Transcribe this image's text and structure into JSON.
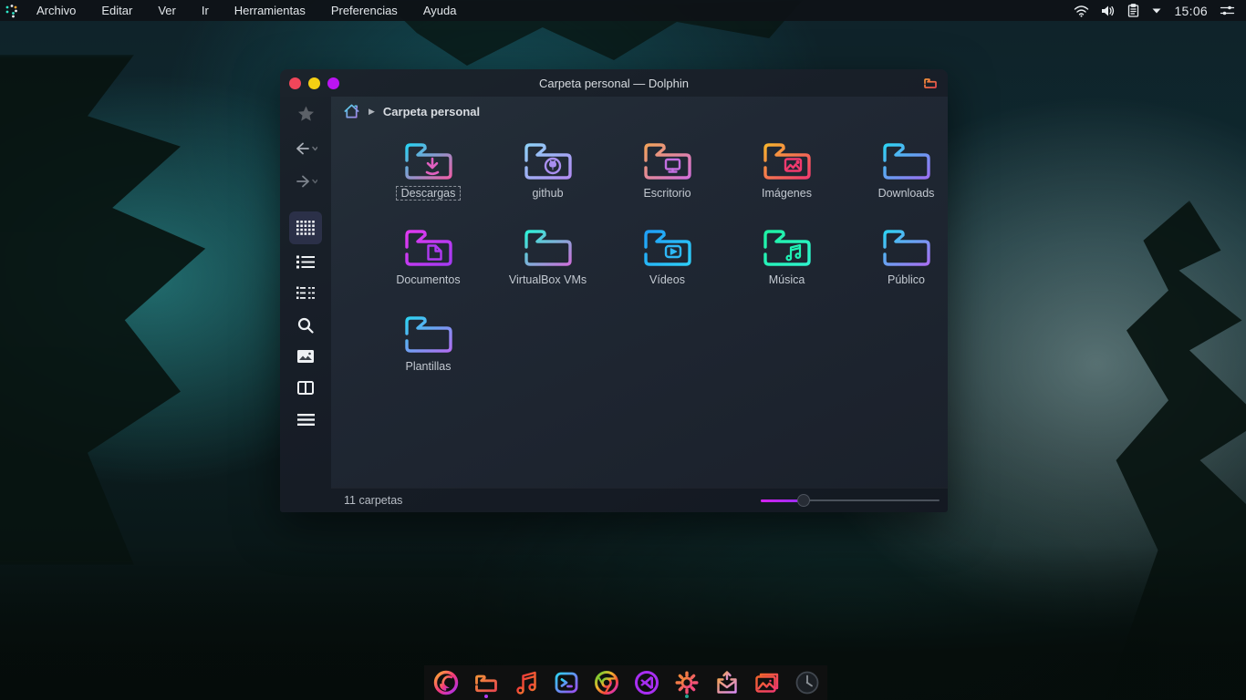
{
  "menubar": {
    "logo": "distro-dotted-question-logo",
    "items": [
      "Archivo",
      "Editar",
      "Ver",
      "Ir",
      "Herramientas",
      "Preferencias",
      "Ayuda"
    ],
    "tray": {
      "icons": [
        "wifi-icon",
        "volume-icon",
        "clipboard-icon",
        "expander-caret-icon",
        "tweaks-sliders-icon"
      ],
      "clock": "15:06"
    }
  },
  "window": {
    "title": "Carpeta personal — Dolphin",
    "app_icon": "orange-folder-icon",
    "traffic_lights": {
      "close": "#f0465a",
      "minimize": "#f5d013",
      "maximize": "#bb14f2"
    },
    "breadcrumb": {
      "root_icon": "home-icon",
      "separator": "▶",
      "current": "Carpeta personal"
    },
    "sidebar": {
      "tools": [
        "favorite-star",
        "back",
        "forward",
        "icons-view (active)",
        "list-view",
        "compact-view",
        "search",
        "preview",
        "split-view",
        "menu"
      ]
    },
    "folders": [
      {
        "label": "Descargas",
        "glyph": "download-arrow",
        "colors": [
          "#29d2f2",
          "#ec5fa8"
        ],
        "selected": true
      },
      {
        "label": "github",
        "glyph": "github-octocat",
        "colors": [
          "#8fd0f7",
          "#b18cf2"
        ],
        "selected": false
      },
      {
        "label": "Escritorio",
        "glyph": "monitor",
        "colors": [
          "#f2a25c",
          "#d36fd9"
        ],
        "selected": false
      },
      {
        "label": "Imágenes",
        "glyph": "image",
        "colors": [
          "#f7b32e",
          "#f23a6e"
        ],
        "selected": false
      },
      {
        "label": "Downloads",
        "glyph": "none",
        "colors": [
          "#2ed2f2",
          "#9b6ef2"
        ],
        "selected": false
      },
      {
        "label": "Documentos",
        "glyph": "document",
        "colors": [
          "#e03af0",
          "#a43af2"
        ],
        "selected": false
      },
      {
        "label": "VirtualBox VMs",
        "glyph": "none",
        "colors": [
          "#2ef2d8",
          "#cc6fd9"
        ],
        "selected": false
      },
      {
        "label": "Vídeos",
        "glyph": "video-play",
        "colors": [
          "#1f9ff7",
          "#2ecdf7"
        ],
        "selected": false
      },
      {
        "label": "Música",
        "glyph": "music-notes",
        "colors": [
          "#1ef2a4",
          "#2ef2cc"
        ],
        "selected": false
      },
      {
        "label": "Público",
        "glyph": "none",
        "colors": [
          "#2ed2f2",
          "#a86ef2"
        ],
        "selected": false
      },
      {
        "label": "Plantillas",
        "glyph": "none",
        "colors": [
          "#2ed2f2",
          "#b06ef2"
        ],
        "selected": false
      }
    ],
    "statusbar": {
      "count": "11 carpetas",
      "zoom_slider_percent": 22
    }
  },
  "dock": {
    "apps": [
      "firefox",
      "file-manager",
      "music-player",
      "terminal",
      "chrome",
      "vscode",
      "settings",
      "mail-share",
      "photos",
      "clock"
    ],
    "running_indicators": [
      "file-manager",
      "settings"
    ]
  }
}
